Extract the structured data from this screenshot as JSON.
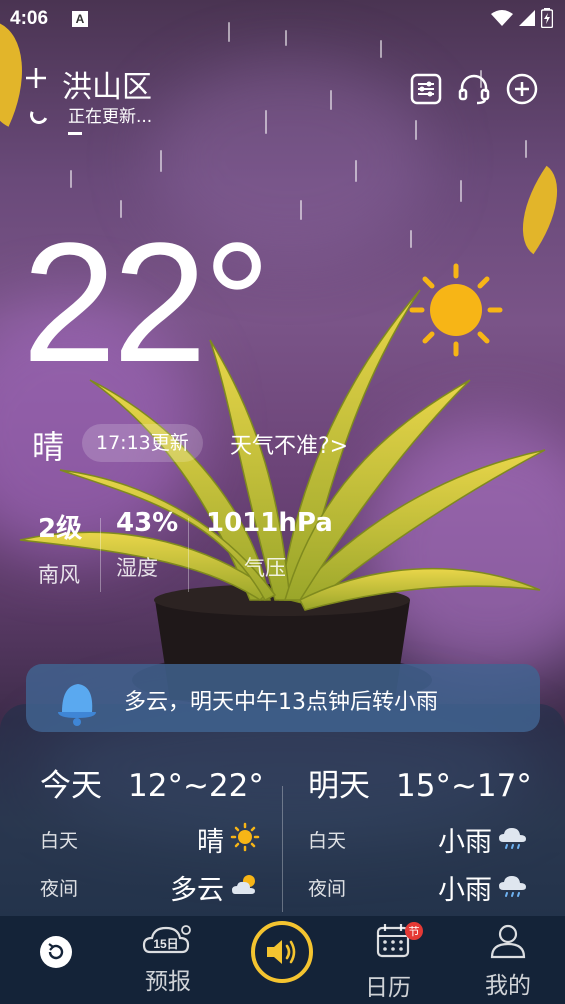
{
  "status_bar": {
    "time": "4:06",
    "notification_badge": "A"
  },
  "header": {
    "location": "洪山区",
    "updating_text": "正在更新..."
  },
  "current": {
    "temperature": "22°",
    "condition": "晴",
    "update_time": "17:13更新",
    "inaccurate_link": "天气不准?>"
  },
  "metrics": [
    {
      "value": "2级",
      "label": "南风"
    },
    {
      "value": "43%",
      "label": "湿度"
    },
    {
      "value": "1011hPa",
      "label": "气压"
    }
  ],
  "notice": {
    "text": "多云，明天中午13点钟后转小雨"
  },
  "forecast": {
    "today": {
      "label": "今天",
      "range": "12°~22°",
      "day_label": "白天",
      "day_cond": "晴",
      "night_label": "夜间",
      "night_cond": "多云"
    },
    "tomorrow": {
      "label": "明天",
      "range": "15°~17°",
      "day_label": "白天",
      "day_cond": "小雨",
      "night_label": "夜间",
      "night_cond": "小雨"
    }
  },
  "nav": {
    "items": [
      {
        "label": "预报",
        "icon_badge": "15日"
      },
      {
        "label": "日历",
        "icon_badge": "节"
      },
      {
        "label": "我的"
      }
    ]
  },
  "colors": {
    "accent": "#f4c430",
    "nav_bg": "#142338",
    "notice_bg": "#41648f",
    "sun": "#f7b516"
  }
}
